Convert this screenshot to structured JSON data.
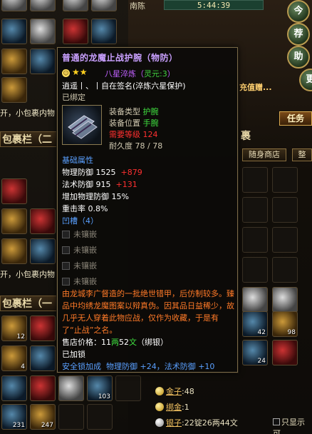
{
  "hud": {
    "place": "南陈",
    "clock": "5:44:39",
    "side_buttons": [
      "今",
      "荐",
      "助",
      "更"
    ],
    "task_button": "任务",
    "popup_text": "充值赠..."
  },
  "left_panel": {
    "bag_title_top": "包裹栏（二",
    "bag_title_bottom": "包裹栏（一",
    "message_top": "开，小包裹内物",
    "message_mid": "开，小包裹内物",
    "slot_counts": [
      "12",
      "4",
      "103",
      "231",
      "247"
    ]
  },
  "right_panel": {
    "title": "裹",
    "tabs": [
      "随身商店",
      "整"
    ],
    "slot_counts": [
      "42",
      "98",
      "24"
    ],
    "currency": [
      {
        "label": "金子",
        "value": ":48"
      },
      {
        "label": "绑金",
        "value": ":1"
      },
      {
        "label": "银子",
        "value": ":22锭26两44文"
      }
    ],
    "checkbox_label": "只显示可"
  },
  "tooltip": {
    "title": "普通的龙魔止战护腕（物防）",
    "stars": [
      "★",
      "★"
    ],
    "refine_text": "八星淬炼（",
    "lingyuan": "灵元:3",
    "refine_close": "）",
    "signature": "逍遥丨、丨自在签名(淬炼六星保护)",
    "bound": "已绑定",
    "equip_type_label": "装备类型",
    "equip_type": "护腕",
    "equip_pos_label": "装备位置",
    "equip_pos": "手腕",
    "req_level_label": "需要等级",
    "req_level": "124",
    "durability_label": "耐久度",
    "durability": "78 / 78",
    "base_attr_label": "基础属性",
    "attrs": [
      {
        "name": "物理防御",
        "value": "1525",
        "bonus": "+879"
      },
      {
        "name": "法术防御",
        "value": "915",
        "bonus": "+131"
      }
    ],
    "extra_attrs": [
      "增加物理防御 15%",
      "重击率  0.8%"
    ],
    "sockets_label": "凹槽（4）",
    "socket_slots": [
      "未镶嵌",
      "未镶嵌",
      "未镶嵌",
      "未镶嵌"
    ],
    "description": "由龙城李广督造的一批绝世错甲，后仿制较多。臻品中均绣龙魔图案以辩真伪。因其品日益稀少，故几乎无人穿着此物应战，仅作为收藏，于是有了“止战”之名。",
    "price_label": "售店价格：",
    "price_liang": "11",
    "price_liang_unit": "两",
    "price_wen": "52",
    "price_wen_unit": "文",
    "price_note": "（绑银）",
    "locked": "已加锁",
    "safety_lock": "安全锁加成",
    "safety_bonus": "物理防御 +24，法术防御 +10"
  },
  "colors": {
    "title_purple": "#c9a0ff",
    "refine_purple": "#c060ff",
    "bonus_red": "#ff3030",
    "green": "#40e040",
    "blue": "#5aa0ff",
    "desc_orange": "#ff7a28"
  }
}
